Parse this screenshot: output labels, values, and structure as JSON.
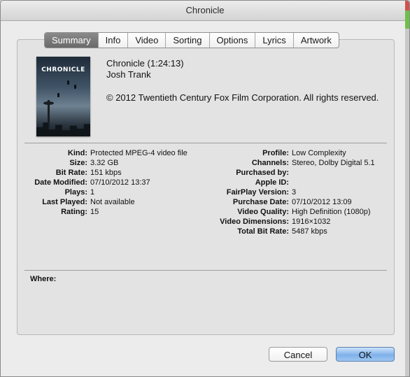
{
  "window": {
    "title": "Chronicle"
  },
  "tabs": [
    "Summary",
    "Info",
    "Video",
    "Sorting",
    "Options",
    "Lyrics",
    "Artwork"
  ],
  "active_tab": "Summary",
  "item": {
    "artwork_text": "CHRONICLE",
    "title_line": "Chronicle (1:24:13)",
    "artist": "Josh Trank",
    "copyright": "© 2012 Twentieth Century Fox Film Corporation. All rights reserved."
  },
  "details_left": [
    {
      "label": "Kind:",
      "value": "Protected MPEG-4 video file"
    },
    {
      "label": "Size:",
      "value": "3.32 GB"
    },
    {
      "label": "Bit Rate:",
      "value": "151 kbps"
    },
    {
      "label": "Date Modified:",
      "value": "07/10/2012 13:37"
    },
    {
      "label": "Plays:",
      "value": "1"
    },
    {
      "label": "Last Played:",
      "value": "Not available"
    },
    {
      "label": "Rating:",
      "value": "15"
    }
  ],
  "details_right": [
    {
      "label": "Profile:",
      "value": "Low Complexity"
    },
    {
      "label": "Channels:",
      "value": "Stereo, Dolby Digital 5.1"
    },
    {
      "label": "Purchased by:",
      "value": ""
    },
    {
      "label": "Apple ID:",
      "value": ""
    },
    {
      "label": "FairPlay Version:",
      "value": "3"
    },
    {
      "label": "Purchase Date:",
      "value": "07/10/2012 13:09"
    },
    {
      "label": "Video Quality:",
      "value": "High Definition (1080p)"
    },
    {
      "label": "Video Dimensions:",
      "value": "1916×1032"
    },
    {
      "label": "Total Bit Rate:",
      "value": "5487 kbps"
    }
  ],
  "where": {
    "label": "Where:"
  },
  "buttons": {
    "cancel": "Cancel",
    "ok": "OK"
  }
}
